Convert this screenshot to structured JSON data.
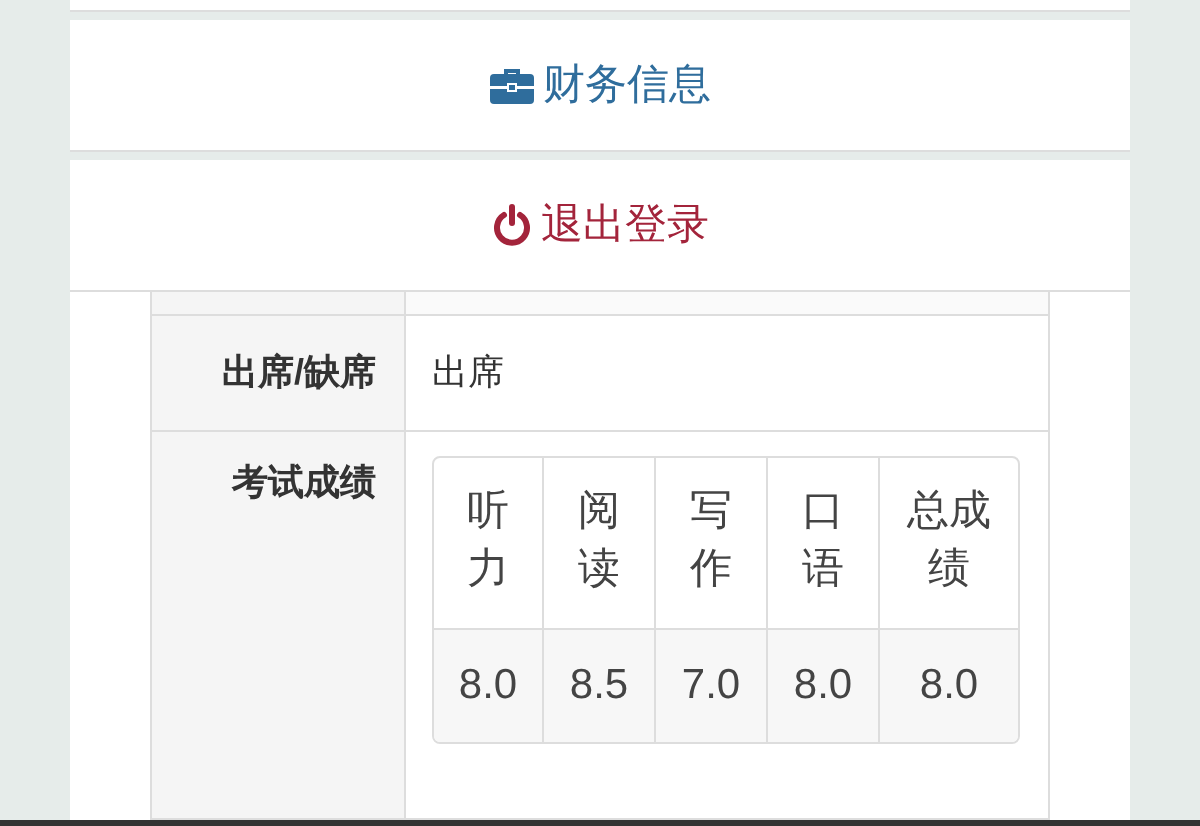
{
  "menu": [
    {
      "kind": "finance",
      "label": "财务信息"
    },
    {
      "kind": "logout",
      "label": "退出登录"
    }
  ],
  "details": [
    {
      "label": "出席/缺席",
      "value": "出席"
    },
    {
      "label": "考试成绩",
      "scores": {
        "headers": [
          "听力",
          "阅读",
          "写作",
          "口语",
          "总成绩"
        ],
        "values": [
          "8.0",
          "8.5",
          "7.0",
          "8.0",
          "8.0"
        ]
      }
    }
  ]
}
